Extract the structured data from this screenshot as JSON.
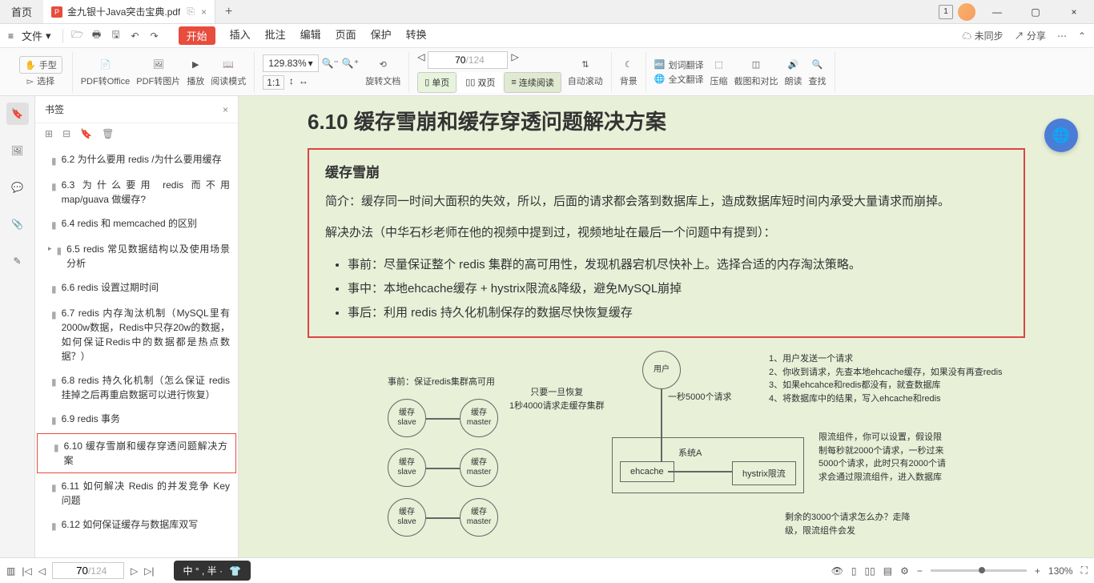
{
  "titlebar": {
    "home": "首页",
    "active_tab": "金九银十Java突击宝典.pdf",
    "badge": "1"
  },
  "menubar": {
    "file": "文件",
    "tabs": [
      "开始",
      "插入",
      "批注",
      "编辑",
      "页面",
      "保护",
      "转换"
    ],
    "unsync": "未同步",
    "share": "分享"
  },
  "toolbar": {
    "hand": "手型",
    "select": "选择",
    "pdf2office": "PDF转Office",
    "pdf2pic": "PDF转图片",
    "play": "播放",
    "readmode": "阅读模式",
    "zoom": "129.83%",
    "rotate": "旋转文档",
    "single": "单页",
    "double": "双页",
    "continuous": "连续阅读",
    "autoscroll": "自动滚动",
    "bg": "背景",
    "dict": "划词翻译",
    "fulltrans": "全文翻译",
    "compress": "压缩",
    "screenshot": "截图和对比",
    "read": "朗读",
    "find": "查找",
    "page_current": "70",
    "page_total": "/124"
  },
  "bookmark": {
    "title": "书签",
    "items": [
      "6.2 为什么要用 redis /为什么要用缓存",
      "6.3 为什么要用 redis 而不用 map/guava 做缓存?",
      "6.4 redis 和 memcached 的区别",
      "6.5 redis 常见数据结构以及使用场景分析",
      "6.6 redis 设置过期时间",
      "6.7 redis 内存淘汰机制（MySQL里有2000w数据，Redis中只存20w的数据，如何保证Redis中的数据都是热点数据？）",
      "6.8 redis 持久化机制（怎么保证 redis 挂掉之后再重启数据可以进行恢复）",
      "6.9 redis 事务",
      "6.10 缓存雪崩和缓存穿透问题解决方案",
      "6.11 如何解决 Redis 的并发竞争 Key 问题",
      "6.12 如何保证缓存与数据库双写"
    ],
    "selected_index": 8,
    "expandable_index": 3
  },
  "content": {
    "section_title": "6.10 缓存雪崩和缓存穿透问题解决方案",
    "box_title": "缓存雪崩",
    "intro": "简介：缓存同一时间大面积的失效，所以，后面的请求都会落到数据库上，造成数据库短时间内承受大量请求而崩掉。",
    "solution_label": "解决办法（中华石杉老师在他的视频中提到过，视频地址在最后一个问题中有提到）：",
    "bullets": [
      "事前：尽量保证整个 redis 集群的高可用性，发现机器宕机尽快补上。选择合适的内存淘汰策略。",
      "事中：本地ehcache缓存 + hystrix限流&降级，避免MySQL崩掉",
      "事后：利用 redis 持久化机制保存的数据尽快恢复缓存"
    ],
    "diagram": {
      "pre_label": "事前：保证redis集群高可用",
      "cache_slave": "缓存\nslave",
      "cache_master": "缓存\nmaster",
      "user": "用户",
      "restore": "只要一旦恢复\n1秒4000请求走缓存集群",
      "system_a": "系统A",
      "ehcache": "ehcache",
      "hystrix": "hystrix限流",
      "per_sec": "一秒5000个请求",
      "steps": "1、用户发送一个请求\n2、你收到请求，先查本地ehcache缓存，如果没有再查redis\n3、如果ehcahce和redis都没有，就查数据库\n4、将数据库中的结果，写入ehcache和redis",
      "limit_text": "限流组件，你可以设置，假设限制每秒就2000个请求，一秒过来5000个请求，此时只有2000个请求会通过限流组件，进入数据库",
      "remain": "剩余的3000个请求怎么办？走降级，限流组件会发"
    }
  },
  "statusbar": {
    "page_current": "70",
    "page_total": "/124",
    "ime": "中 ° , 半 ·",
    "zoom": "130%"
  }
}
